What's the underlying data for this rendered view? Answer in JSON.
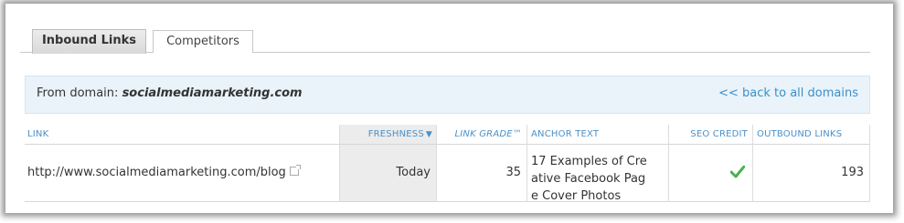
{
  "tabs": [
    {
      "label": "Inbound Links"
    },
    {
      "label": "Competitors"
    }
  ],
  "banner": {
    "prefix": "From domain:",
    "domain": "socialmediamarketing.com",
    "back_link": "<< back to all domains"
  },
  "table": {
    "headers": {
      "link": "LINK",
      "freshness": "FRESHNESS",
      "link_grade": "LINK GRADE™",
      "anchor_text": "ANCHOR TEXT",
      "seo_credit": "SEO CREDIT",
      "outbound_links": "OUTBOUND LINKS"
    },
    "rows": [
      {
        "link": "http://www.socialmediamarketing.com/blog",
        "freshness": "Today",
        "link_grade": "35",
        "anchor_line1": "17 Examples of Cre",
        "anchor_line2": "ative Facebook Pag",
        "anchor_line3": "e Cover Photos",
        "seo_credit": "check-icon",
        "outbound_links": "193"
      }
    ]
  },
  "colors": {
    "accent": "#4a90c8",
    "banner_bg": "#e9f3f9",
    "check": "#4caf50"
  }
}
